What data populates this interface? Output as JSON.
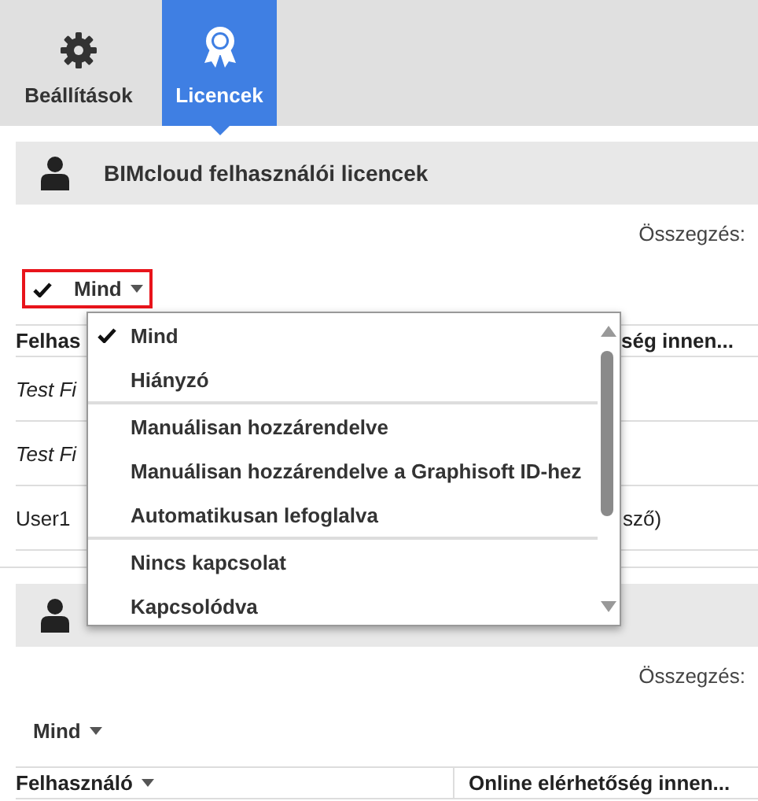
{
  "tabs": [
    {
      "label": "Beállítások",
      "selected": false
    },
    {
      "label": "Licencek",
      "selected": true
    }
  ],
  "sections": [
    {
      "title": "BIMcloud felhasználói licencek",
      "summary_label": "Összegzés:",
      "filter": {
        "label": "Mind",
        "checked": true,
        "highlighted": true
      },
      "table": {
        "columns": [
          {
            "label": "Felhas"
          },
          {
            "label": "ség innen..."
          }
        ],
        "rows": [
          {
            "user": "Test Fi",
            "italic": true
          },
          {
            "user": "Test Fi",
            "italic": true
          },
          {
            "user": "User1",
            "online": "sző)",
            "italic": false
          }
        ]
      }
    },
    {
      "summary_label": "Összegzés:",
      "filter": {
        "label": "Mind",
        "checked": false,
        "highlighted": false
      },
      "table": {
        "columns": [
          {
            "label": "Felhasználó",
            "sort_caret": true
          },
          {
            "label": "Online elérhetőség innen...",
            "sort_caret": false
          }
        ]
      }
    }
  ],
  "dropdown": {
    "groups": [
      {
        "items": [
          {
            "label": "Mind",
            "selected": true
          },
          {
            "label": "Hiányzó",
            "selected": false
          }
        ]
      },
      {
        "items": [
          {
            "label": "Manuálisan hozzárendelve",
            "selected": false
          },
          {
            "label": "Manuálisan hozzárendelve a Graphisoft ID-hez",
            "selected": false
          },
          {
            "label": "Automatikusan lefoglalva",
            "selected": false
          }
        ]
      },
      {
        "items": [
          {
            "label": "Nincs kapcsolat",
            "selected": false
          },
          {
            "label": "Kapcsolódva",
            "selected": false
          }
        ]
      }
    ]
  }
}
